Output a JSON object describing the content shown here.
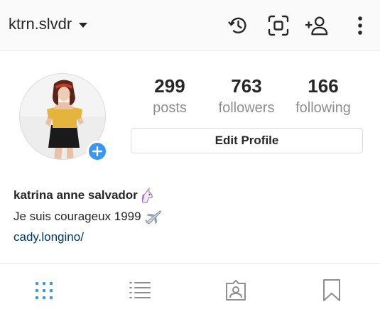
{
  "header": {
    "username": "ktrn.slvdr",
    "icons": [
      "history-icon",
      "scan-icon",
      "add-user-icon",
      "more-vertical-icon"
    ]
  },
  "stats": [
    {
      "value": "299",
      "label": "posts"
    },
    {
      "value": "763",
      "label": "followers"
    },
    {
      "value": "166",
      "label": "following"
    }
  ],
  "edit_profile_label": "Edit Profile",
  "bio": {
    "name": "katrina anne salvador",
    "text": "Je suis courageux 1999",
    "link": "cady.longino/"
  },
  "tabs": [
    "grid-icon",
    "list-icon",
    "tagged-icon",
    "saved-icon"
  ],
  "colors": {
    "accent": "#3897f0",
    "link": "#003569",
    "text": "#262626",
    "muted": "#8e8e8e",
    "border": "#dbdbdb"
  }
}
